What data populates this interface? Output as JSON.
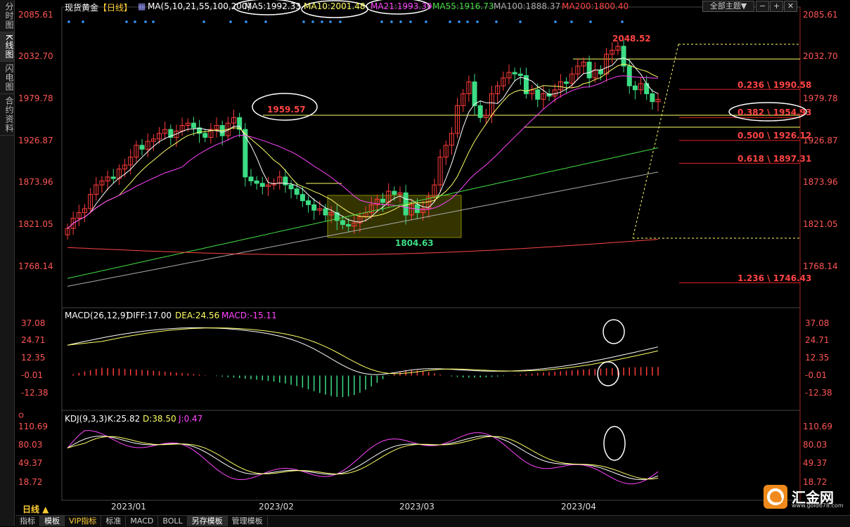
{
  "sidebar": {
    "items": [
      "分时图",
      "K线图",
      "闪电图",
      "合约资料"
    ],
    "active": 1
  },
  "header": {
    "symbol": "现货黄金",
    "period_tag": "【日线】",
    "ma_label": "MA(5,10,21,55,100,200)",
    "ma_values": [
      {
        "text": "MA5:1992.33",
        "color": "#ffffff"
      },
      {
        "text": "MA10:2001.48",
        "color": "#ffff66"
      },
      {
        "text": "MA21:1993.39",
        "color": "#ff44ff"
      },
      {
        "text": "MA55:1916.73",
        "color": "#44dd44"
      },
      {
        "text": "MA100:1888.37",
        "color": "#aaaaaa"
      },
      {
        "text": "MA200:1800.40",
        "color": "#ff4444"
      }
    ],
    "topic_button": "全部主题▼"
  },
  "price_axis": [
    "2085.61",
    "2032.70",
    "1979.78",
    "1926.87",
    "1873.96",
    "1821.05",
    "1768.14"
  ],
  "fib_levels": [
    {
      "text": "0.236 \\ 1990.58",
      "price": 1990.58
    },
    {
      "text": "0.382 \\ 1954.93",
      "price": 1954.93
    },
    {
      "text": "0.500 \\ 1926.12",
      "price": 1926.12
    },
    {
      "text": "0.618 \\ 1897.31",
      "price": 1897.31
    },
    {
      "text": "1.236 \\ 1746.43",
      "price": 1746.43
    }
  ],
  "annotations": {
    "high": "2048.52",
    "peak_feb": "1959.57",
    "low": "1804.63"
  },
  "macd": {
    "label": "MACD(26,12,9)",
    "diff": "DIFF:17.00",
    "dea": "DEA:24.56",
    "macd": "MACD:-15.11",
    "axis": [
      "37.08",
      "24.71",
      "12.35",
      "-0.01",
      "-12.38"
    ]
  },
  "kdj": {
    "label": "KDJ(9,3,3)",
    "k": "K:25.82",
    "d": "D:38.50",
    "j": "J:0.47",
    "axis": [
      "110.69",
      "80.03",
      "49.37",
      "18.72"
    ]
  },
  "x_axis": [
    "2023/01",
    "2023/02",
    "2023/03",
    "2023/04"
  ],
  "period_label": "日线 ▲",
  "toolbar": [
    "指标",
    "模板",
    "VIP指标",
    "标准",
    "MACD",
    "BOLL",
    "另存模板",
    "管理模板"
  ],
  "logo": {
    "text": "汇金网",
    "url": "www.gold678.com"
  },
  "colors": {
    "up": "#ff3b3b",
    "down": "#3ddc84",
    "ma5": "#ffffff",
    "ma10": "#ffff66",
    "ma21": "#ff44ff",
    "ma55": "#44dd44",
    "ma100": "#aaaaaa",
    "ma200": "#ff4444"
  },
  "chart_data": {
    "type": "candlestick",
    "x": [
      "2023/01",
      "2023/02",
      "2023/03",
      "2023/04"
    ],
    "ohlc_close_approx": [
      1815,
      1828,
      1835,
      1840,
      1858,
      1870,
      1875,
      1880,
      1878,
      1890,
      1895,
      1905,
      1920,
      1915,
      1925,
      1928,
      1935,
      1940,
      1930,
      1938,
      1945,
      1948,
      1942,
      1935,
      1930,
      1940,
      1945,
      1932,
      1948,
      1955,
      1940,
      1880,
      1875,
      1872,
      1868,
      1870,
      1872,
      1880,
      1870,
      1865,
      1858,
      1850,
      1845,
      1838,
      1840,
      1832,
      1835,
      1825,
      1820,
      1818,
      1822,
      1830,
      1835,
      1845,
      1852,
      1848,
      1862,
      1858,
      1860,
      1832,
      1845,
      1835,
      1840,
      1855,
      1870,
      1905,
      1920,
      1935,
      1970,
      1985,
      2000,
      1970,
      1955,
      1958,
      1985,
      1995,
      2005,
      2012,
      2010,
      2008,
      1985,
      1990,
      1978,
      1985,
      1982,
      1990,
      2000,
      1998,
      2010,
      2020,
      2025,
      2005,
      2015,
      2010,
      2035,
      2040,
      2045,
      2020,
      1995,
      1990,
      1998,
      1985,
      1975,
      1978
    ],
    "series": [
      {
        "name": "MA5",
        "value": 1992.33
      },
      {
        "name": "MA10",
        "value": 2001.48
      },
      {
        "name": "MA21",
        "value": 1993.39
      },
      {
        "name": "MA55",
        "value": 1916.73
      },
      {
        "name": "MA100",
        "value": 1888.37
      },
      {
        "name": "MA200",
        "value": 1800.4
      }
    ],
    "ylim": [
      1768.14,
      2085.61
    ],
    "high": 2048.52,
    "low": 1804.63,
    "macd": {
      "diff": 17.0,
      "dea": 24.56,
      "macd": -15.11,
      "ylim": [
        -12.38,
        37.08
      ]
    },
    "kdj": {
      "k": 25.82,
      "d": 38.5,
      "j": 0.47,
      "ylim": [
        18.72,
        110.69
      ]
    }
  }
}
